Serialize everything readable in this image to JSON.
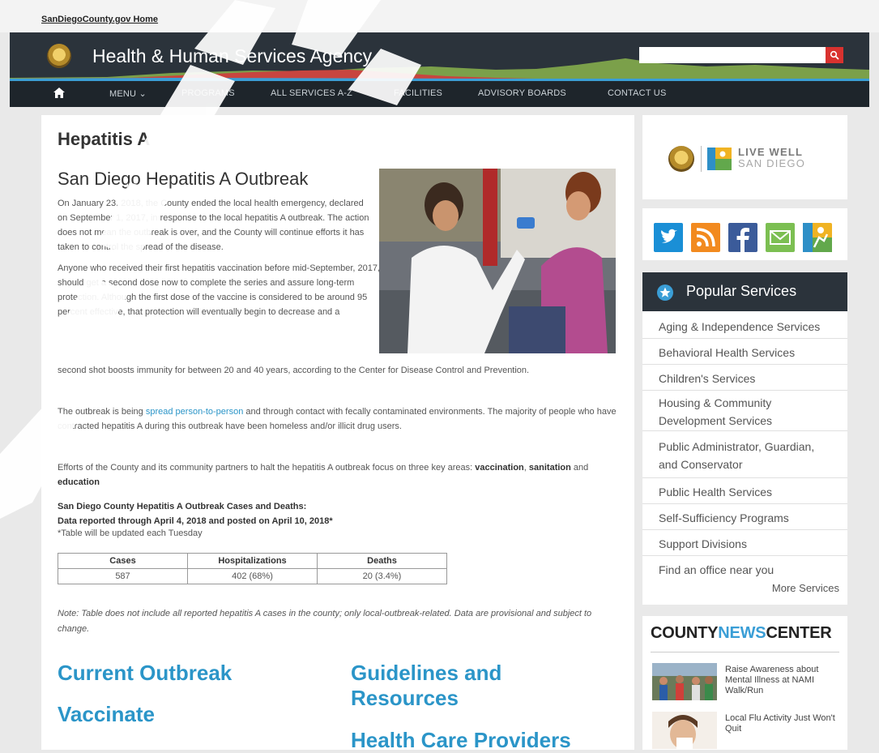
{
  "topbar": {
    "home_link": "SanDiegoCounty.gov Home"
  },
  "header": {
    "agency_title": "Health & Human Services Agency",
    "search": {
      "placeholder": "",
      "value": ""
    },
    "colors": {
      "bg": "#2b333b",
      "hill_red": "#c8453f",
      "hill_green": "#7ba04a",
      "accent_blue": "#3a9ed6",
      "search_red": "#d9322f"
    }
  },
  "nav": {
    "home_icon": "home-icon",
    "items": [
      "MENU",
      "PROGRAMS",
      "ALL SERVICES A-Z",
      "FACILITIES",
      "ADVISORY BOARDS",
      "CONTACT US"
    ]
  },
  "main": {
    "page_title": "Hepatitis A",
    "outbreak_title": "San Diego Hepatitis A Outbreak",
    "para1": "On January 23, 2018, the County ended the local health emergency, declared on September 1, 2017, in response to the local hepatitis A outbreak. The action does not mean the outbreak is over, and the County will continue efforts it has taken to control the spread of the disease.",
    "para2": "Anyone who received their first hepatitis vaccination before mid-September, 2017, should get a second dose now to complete the series and assure long-term protection. Although the first dose of the vaccine is considered to be around 95 percent effective, that protection will eventually begin to decrease and a",
    "para2_cont": "second shot boosts immunity for between 20 and 40 years, according to the Center for Disease Control and Prevention.",
    "para3_before": "The outbreak is being ",
    "para3_link": "spread person-to-person",
    "para3_after": " and through contact with fecally contaminated environments. The majority of people who have contracted hepatitis A during this outbreak have been homeless and/or illicit drug users.",
    "para4_before": "Efforts of the County and its community partners to halt the hepatitis A outbreak focus on three key areas: ",
    "para4_b1": "vaccination",
    "para4_sep1": ", ",
    "para4_b2": "sanitation",
    "para4_sep2": " and ",
    "para4_b3": "education",
    "cases_heading_line1": "San Diego County Hepatitis A Outbreak Cases and Deaths:",
    "cases_heading_line2": "Data reported through April 4, 2018 and posted on April 10, 2018*",
    "table_note": "*Table will be updated each Tuesday",
    "table": {
      "headers": [
        "Cases",
        "Hospitalizations",
        "Deaths"
      ],
      "row": [
        "587",
        "402 (68%)",
        "20 (3.4%)"
      ]
    },
    "note": "Note: Table does not include all reported hepatitis A cases in the county; only local-outbreak-related. Data are provisional and subject to change.",
    "links": {
      "current_outbreak": "Current Outbreak",
      "vaccinate": "Vaccinate",
      "guidelines": "Guidelines and Resources",
      "health_care": "Health Care Providers"
    }
  },
  "sidebar": {
    "livewell": {
      "line1": "LIVE WELL",
      "line2": "SAN DIEGO"
    },
    "social_icons": [
      "twitter-icon",
      "rss-icon",
      "facebook-icon",
      "email-icon",
      "livewell-icon"
    ],
    "popular": {
      "title": "Popular Services",
      "items": [
        "Aging & Independence Services",
        "Behavioral Health Services",
        "Children's Services",
        "Housing & Community Development Services",
        "Public Administrator, Guardian, and Conservator",
        "Public Health Services",
        "Self-Sufficiency Programs",
        "Support Divisions",
        "Find an office near you"
      ],
      "more": "More Services"
    },
    "news": {
      "title_part1": "COUNTY",
      "title_part2": "NEWS",
      "title_part3": "CENTER",
      "items": [
        "Raise Awareness about Mental Illness at NAMI Walk/Run",
        "Local Flu Activity Just Won't Quit"
      ]
    }
  }
}
